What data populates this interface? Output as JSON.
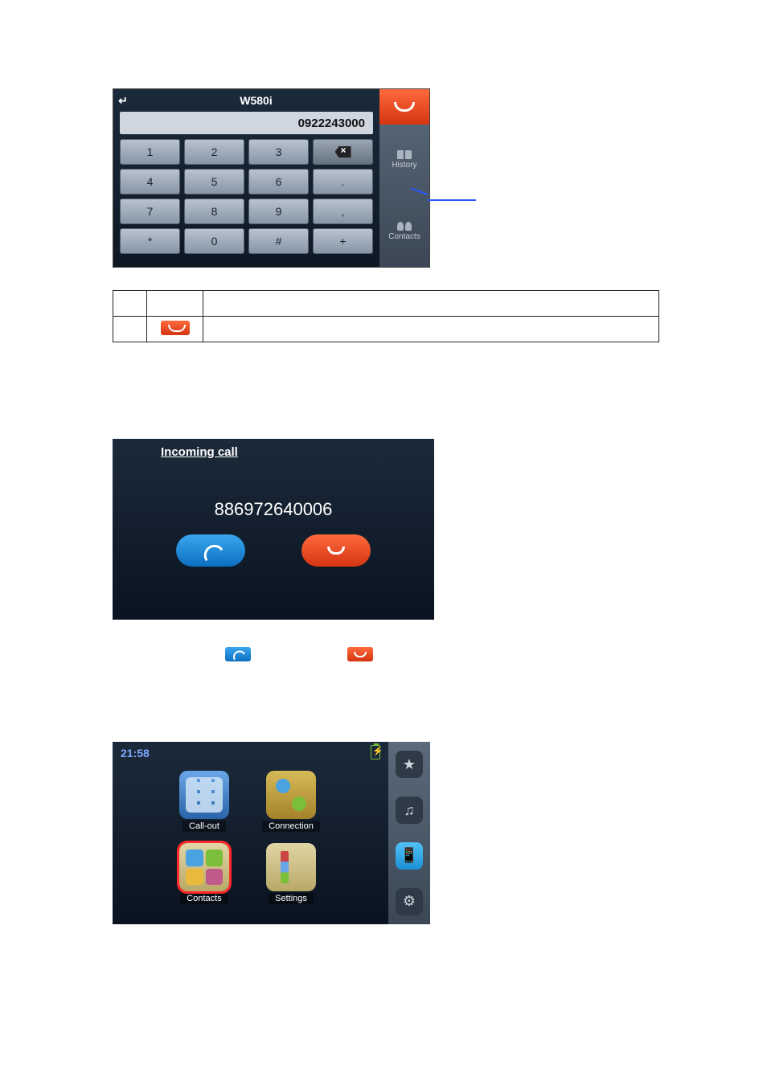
{
  "dialpad": {
    "device_title": "W580i",
    "entered_number": "0922243000",
    "keys": [
      "1",
      "2",
      "3",
      "BSP",
      "4",
      "5",
      "6",
      ".",
      "7",
      "8",
      "9",
      ",",
      "*",
      "0",
      "#",
      "+"
    ],
    "side": {
      "hangup": "hangup",
      "history_label": "History",
      "contacts_label": "Contacts"
    }
  },
  "icon_table": {
    "rows": [
      {
        "idx": "",
        "label": "",
        "desc": ""
      },
      {
        "idx": "",
        "label": "",
        "desc": ""
      }
    ]
  },
  "incoming_call": {
    "title": "Incoming call",
    "number": "886972640006"
  },
  "menu": {
    "time": "21:58",
    "items": [
      {
        "label": "Call-out"
      },
      {
        "label": "Connection"
      },
      {
        "label": "Contacts"
      },
      {
        "label": "Settings"
      }
    ],
    "side_icons": [
      "star",
      "clapper",
      "phone-bt",
      "gear"
    ]
  }
}
